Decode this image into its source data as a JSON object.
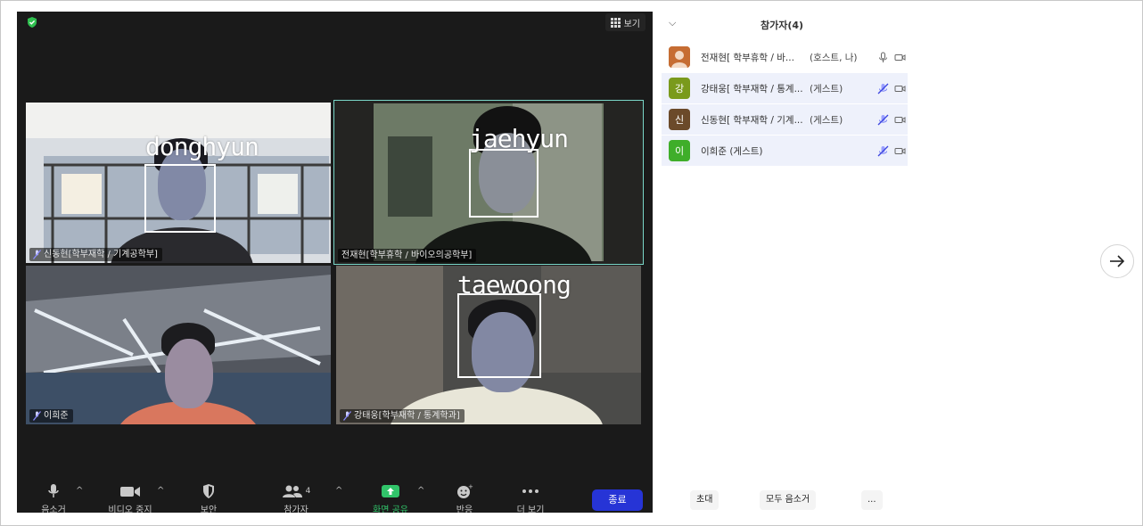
{
  "meeting": {
    "view_label": "보기",
    "tiles": [
      {
        "name": "신동현[학부재학 / 기계공학부]",
        "face_label": "donghyun",
        "muted": true,
        "active": false
      },
      {
        "name": "전재현[학부휴학 / 바이오의공학부]",
        "face_label": "jaehyun",
        "muted": false,
        "active": true
      },
      {
        "name": "이희준",
        "face_label": "",
        "muted": true,
        "active": false
      },
      {
        "name": "강태웅[학부재학 / 통계학과]",
        "face_label": "taewoong",
        "muted": true,
        "active": false
      }
    ],
    "toolbar": {
      "mute": "음소거",
      "video": "비디오 중지",
      "security": "보안",
      "participants": "참가자",
      "participants_count": "4",
      "share": "화면 공유",
      "reactions": "반응",
      "more": "더 보기",
      "end": "종료"
    }
  },
  "panel": {
    "title": "참가자(4)",
    "participants": [
      {
        "name": "전재현[ 학부휴학 / 바...",
        "role": "(호스트, 나)",
        "avatar_text": "",
        "avatar_color": "#b5622c",
        "muted": false,
        "highlight": false
      },
      {
        "name": "강태웅[ 학부재학 / 통계...",
        "role": "(게스트)",
        "avatar_text": "강",
        "avatar_color": "#7a9a1c",
        "muted": true,
        "highlight": true
      },
      {
        "name": "신동현[ 학부재학 / 기계...",
        "role": "(게스트)",
        "avatar_text": "신",
        "avatar_color": "#6b4a2a",
        "muted": true,
        "highlight": true
      },
      {
        "name": "이희준 (게스트)",
        "role": "",
        "avatar_text": "이",
        "avatar_color": "#3fae2a",
        "muted": true,
        "highlight": true
      }
    ],
    "invite": "초대",
    "mute_all": "모두 음소거",
    "more": "..."
  },
  "colors": {
    "active_border": "#7ad7c9",
    "end_button": "#2634d6",
    "share_green": "#31c46a"
  },
  "icons": [
    "shield-icon",
    "grid-icon",
    "mic-icon",
    "video-icon",
    "security-icon",
    "participants-icon",
    "share-icon",
    "reactions-icon",
    "more-icon",
    "mic-muted-icon",
    "camera-off-icon",
    "arrow-right-icon",
    "chevron-down-icon"
  ]
}
